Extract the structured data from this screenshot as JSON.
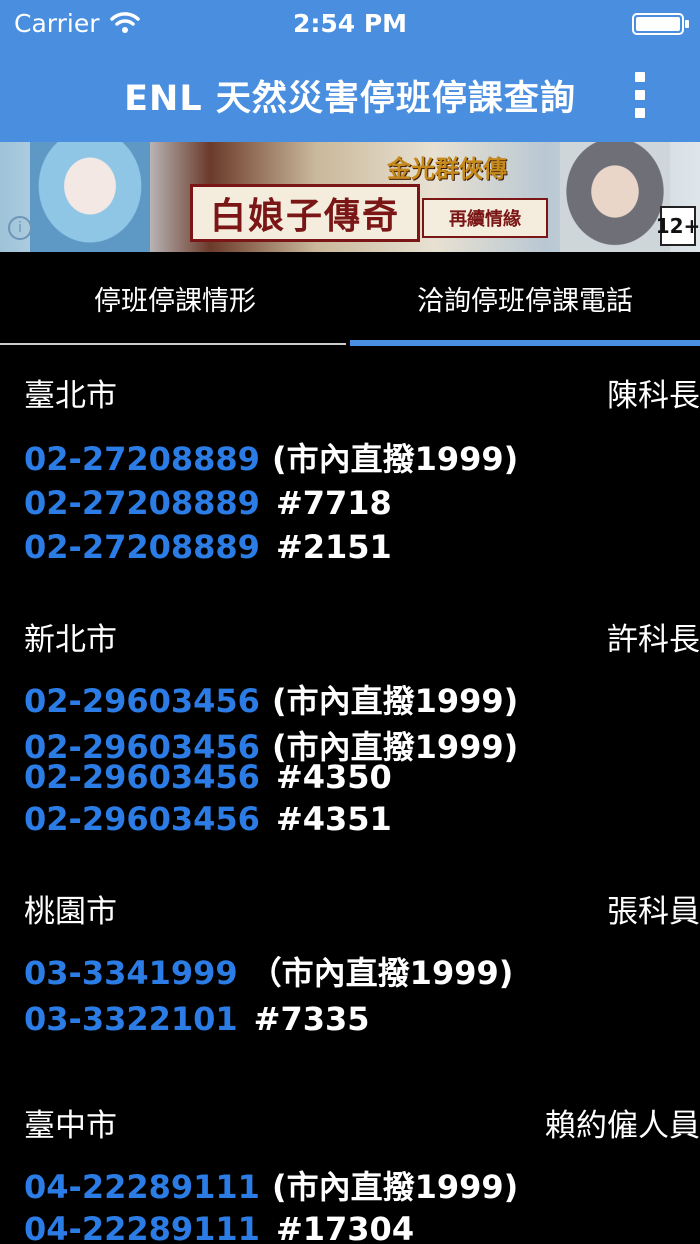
{
  "status_bar": {
    "carrier": "Carrier",
    "time": "2:54 PM",
    "wifi_icon": "wifi-icon",
    "battery_icon": "battery-icon"
  },
  "nav_bar": {
    "title": "ENL 天然災害停班停課查詢",
    "menu_icon": "more-vertical-icon",
    "background": "#4a8ee0"
  },
  "banner": {
    "title": "白娘子傳奇",
    "subtitle": "再續情緣",
    "logo": "金光群俠傳",
    "rating": "12+",
    "info_icon": "i"
  },
  "tabs": [
    {
      "label": "停班停課情形",
      "selected": false
    },
    {
      "label": "洽詢停班停課電話",
      "selected": true
    }
  ],
  "accent_color": "#2c7ce6",
  "contacts": [
    {
      "city": "臺北市",
      "officer": "陳科長",
      "lines": [
        {
          "phone": "02-27208889",
          "suffix": "(市內直撥1999)"
        },
        {
          "phone": "02-27208889",
          "suffix": "#7718"
        },
        {
          "phone": "02-27208889",
          "suffix": "#2151"
        }
      ]
    },
    {
      "city": "新北市",
      "officer": "許科長",
      "lines": [
        {
          "phone": "02-29603456",
          "suffix": "(市內直撥1999)"
        },
        {
          "phone": "02-29603456",
          "suffix": "(市內直撥1999)"
        },
        {
          "phone": "02-29603456",
          "suffix": "#4350"
        },
        {
          "phone": "02-29603456",
          "suffix": "#4351"
        }
      ]
    },
    {
      "city": "桃園市",
      "officer": "張科員",
      "lines": [
        {
          "phone": "03-3341999",
          "suffix": "（市內直撥1999)"
        },
        {
          "phone": "03-3322101",
          "suffix": "#7335"
        }
      ]
    },
    {
      "city": "臺中市",
      "officer": "賴約僱人員",
      "lines": [
        {
          "phone": "04-22289111",
          "suffix": "(市內直撥1999)"
        },
        {
          "phone": "04-22289111",
          "suffix": "#17304"
        }
      ]
    }
  ]
}
